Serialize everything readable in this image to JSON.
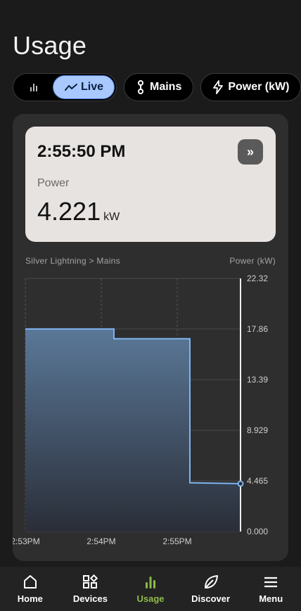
{
  "page": {
    "title": "Usage"
  },
  "filters": {
    "view_toggle": {
      "bars_icon": "bar-chart-icon",
      "live_label": "Live",
      "live_icon": "trend-line-icon"
    },
    "chips": [
      {
        "label": "Mains",
        "icon": "probe-icon"
      },
      {
        "label": "Power (kW)",
        "icon": "lightning-icon"
      }
    ]
  },
  "reading": {
    "time": "2:55:50 PM",
    "label": "Power",
    "value": "4.221",
    "unit": "kW",
    "next_icon": "double-chevron-right-icon"
  },
  "chart_header": {
    "source": "Silver Lightning > Mains",
    "metric": "Power (kW)"
  },
  "chart_data": {
    "type": "area",
    "xlabel": "",
    "ylabel": "Power (kW)",
    "ylim": [
      0,
      22.32
    ],
    "y_ticks": [
      "22.32",
      "17.86",
      "13.39",
      "8.929",
      "4.465",
      "0.000"
    ],
    "x_ticks": [
      "2:53PM",
      "2:54PM",
      "2:55PM"
    ],
    "series": [
      {
        "values": [
          {
            "x": "2:53:00 PM",
            "y": 17.86
          },
          {
            "x": "2:54:10 PM",
            "y": 17.86
          },
          {
            "x": "2:54:10 PM",
            "y": 17.0
          },
          {
            "x": "2:55:10 PM",
            "y": 17.0
          },
          {
            "x": "2:55:10 PM",
            "y": 4.3
          },
          {
            "x": "2:55:50 PM",
            "y": 4.221
          }
        ]
      }
    ],
    "colors": {
      "line": "#7fb4ef",
      "fill_top": "#5a7898",
      "fill_bottom": "#2a2e38"
    },
    "grid": true
  },
  "nav": {
    "items": [
      {
        "label": "Home",
        "icon": "home-icon",
        "active": false
      },
      {
        "label": "Devices",
        "icon": "devices-icon",
        "active": false
      },
      {
        "label": "Usage",
        "icon": "usage-icon",
        "active": true
      },
      {
        "label": "Discover",
        "icon": "leaf-icon",
        "active": false
      },
      {
        "label": "Menu",
        "icon": "menu-icon",
        "active": false
      }
    ],
    "accent": "#8fb94a"
  }
}
